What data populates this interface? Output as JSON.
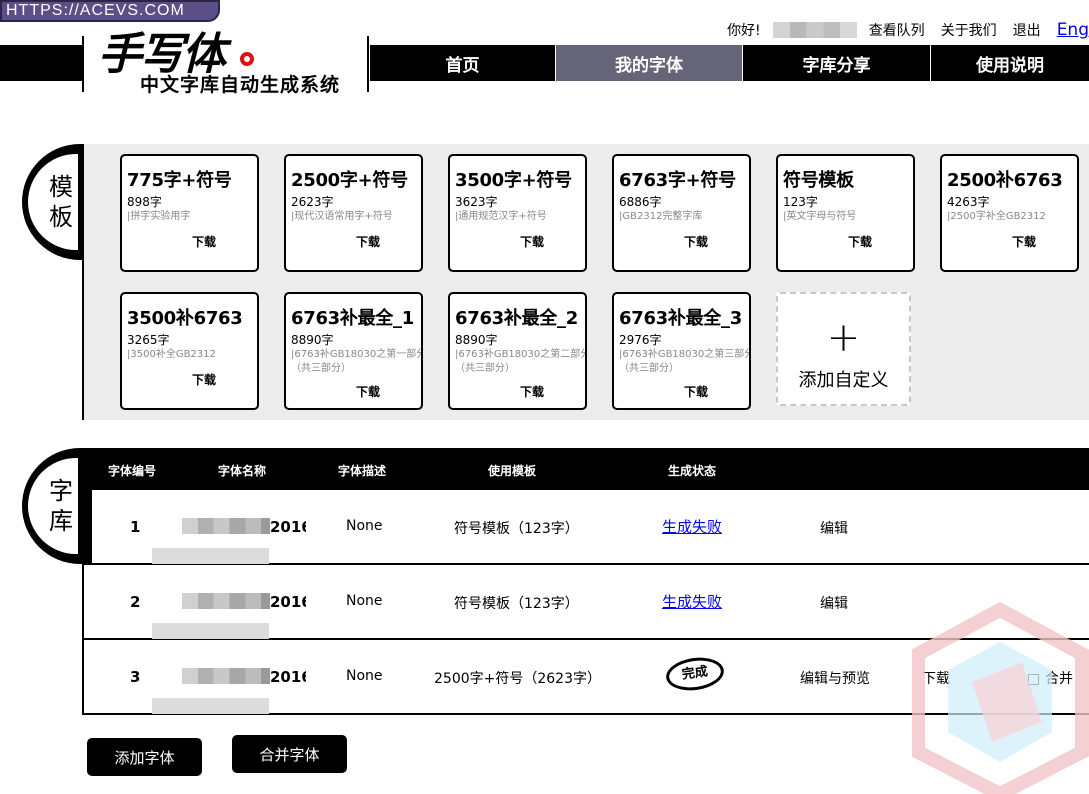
{
  "watermark_url": "HTTPS://ACEVS.COM",
  "header": {
    "greeting": "你好!",
    "queue_link": "查看队列",
    "about_link": "关于我们",
    "logout_link": "退出",
    "lang_link": "Eng"
  },
  "logo": {
    "title": "手写体",
    "subtitle": "中文字库自动生成系统"
  },
  "nav": {
    "items": [
      "首页",
      "我的字体",
      "字库分享",
      "使用说明"
    ],
    "active": "我的字体"
  },
  "templates": {
    "section_label": [
      "模",
      "板"
    ],
    "cards": [
      {
        "title": "775字+符号",
        "count": "898字",
        "desc": "|拼字实验用字",
        "action": "下载"
      },
      {
        "title": "2500字+符号",
        "count": "2623字",
        "desc": "|现代汉语常用字+符号",
        "action": "下载"
      },
      {
        "title": "3500字+符号",
        "count": "3623字",
        "desc": "|通用规范汉字+符号",
        "action": "下载"
      },
      {
        "title": "6763字+符号",
        "count": "6886字",
        "desc": "|GB2312完整字库",
        "action": "下载"
      },
      {
        "title": "符号模板",
        "count": "123字",
        "desc": "|英文字母与符号",
        "action": "下载"
      },
      {
        "title": "2500补6763",
        "count": "4263字",
        "desc": "|2500字补全GB2312",
        "action": "下载"
      },
      {
        "title": "3500补6763",
        "count": "3265字",
        "desc": "|3500补全GB2312",
        "action": "下载"
      },
      {
        "title": "6763补最全_1",
        "count": "8890字",
        "desc": "|6763补GB18030之第一部分",
        "desc2": "（共三部分）",
        "action": "下载"
      },
      {
        "title": "6763补最全_2",
        "count": "8890字",
        "desc": "|6763补GB18030之第二部分",
        "desc2": "（共三部分）",
        "action": "下载"
      },
      {
        "title": "6763补最全_3",
        "count": "2976字",
        "desc": "|6763补GB18030之第三部分",
        "desc2": "（共三部分）",
        "action": "下载"
      }
    ],
    "add_custom": {
      "icon": "+",
      "label": "添加自定义"
    }
  },
  "library": {
    "section_label": [
      "字",
      "库"
    ],
    "columns": [
      "字体编号",
      "字体名称",
      "字体描述",
      "使用模板",
      "生成状态"
    ],
    "rows": [
      {
        "id": "1",
        "name_suffix": "2016",
        "desc": "None",
        "template": "符号模板（123字）",
        "status": "生成失败",
        "edit": "编辑"
      },
      {
        "id": "2",
        "name_suffix": "2016",
        "desc": "None",
        "template": "符号模板（123字）",
        "status": "生成失败",
        "edit": "编辑"
      },
      {
        "id": "3",
        "name_suffix": "2016",
        "desc": "None",
        "template": "2500字+符号（2623字）",
        "status": "完成",
        "edit": "编辑与预览",
        "download": "下载",
        "merge": "合并"
      }
    ]
  },
  "buttons": {
    "add_font": "添加字体",
    "merge_font": "合并字体"
  },
  "colors": {
    "nav_bg": "#000000",
    "nav_active": "#666577",
    "badge": "#5a4f86",
    "link": "#0000ee",
    "panel_bg": "#ececec"
  }
}
